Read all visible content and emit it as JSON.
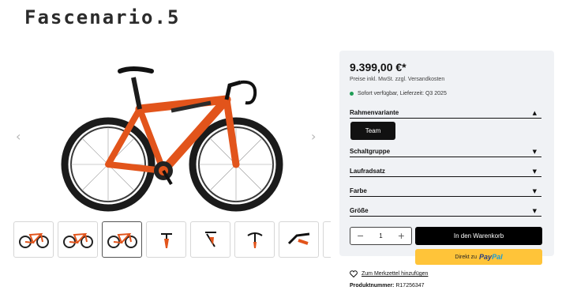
{
  "product": {
    "title": "Fascenario.5"
  },
  "gallery": {
    "prev_icon": "chevron-left-icon",
    "next_icon": "chevron-right-icon",
    "thumbs": [
      "side",
      "side",
      "side",
      "front",
      "rear",
      "handlebar",
      "drivetrain",
      "detail"
    ]
  },
  "pricing": {
    "price": "9.399,00 €*",
    "tax_note": "Preise inkl. MwSt. zzgl. Versandkosten",
    "availability": "Sofort verfügbar, Lieferzeit: Q3 2025",
    "availability_color": "#1f9d55"
  },
  "options": {
    "frame": {
      "label": "Rahmenvariante",
      "selected": "Team"
    },
    "groupset": {
      "label": "Schaltgruppe"
    },
    "wheels": {
      "label": "Laufradsatz"
    },
    "color": {
      "label": "Farbe"
    },
    "size": {
      "label": "Größe"
    }
  },
  "cart": {
    "quantity": "1",
    "minus": "−",
    "plus": "+",
    "add_label": "In den Warenkorb",
    "paypal_prefix": "Direkt zu",
    "paypal_brand_a": "Pay",
    "paypal_brand_b": "Pal"
  },
  "extras": {
    "wishlist": "Zum Merkzettel hinzufügen",
    "sku_label": "Produktnummer:",
    "sku_value": "R17256347"
  },
  "colors": {
    "accent_orange": "#e2541b",
    "paypal_yellow": "#ffc439"
  }
}
